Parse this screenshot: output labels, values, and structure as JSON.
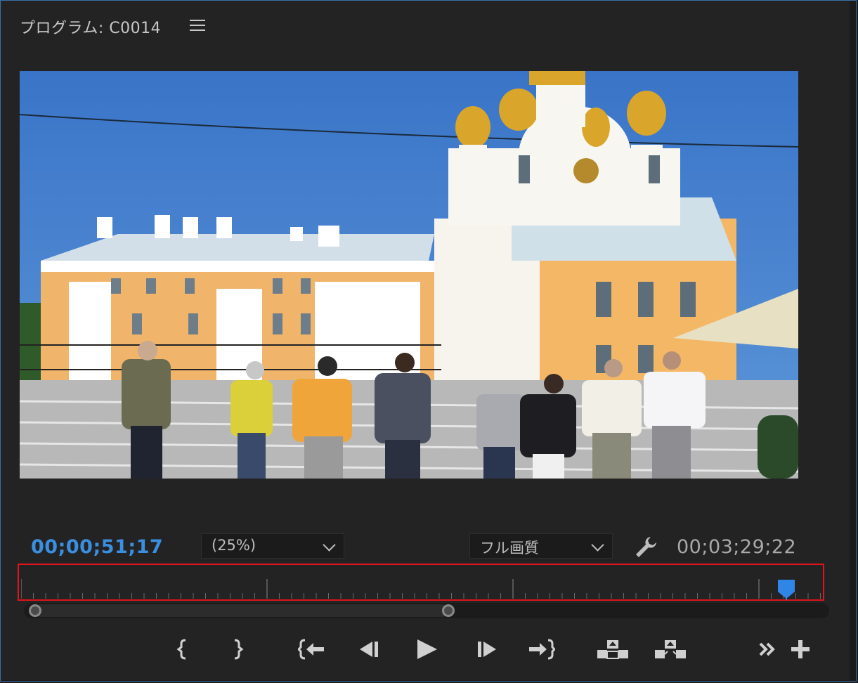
{
  "panel": {
    "title": "プログラム: C0014"
  },
  "playback": {
    "current_timecode": "00;00;51;17",
    "duration_timecode": "00;03;29;22",
    "zoom_level": "(25%)",
    "quality": "フル画質"
  },
  "timeline": {
    "playhead_position_fraction": 0.955,
    "zoom_scroll_start_fraction": 0.0,
    "zoom_scroll_end_fraction": 0.53
  },
  "controls": [
    {
      "name": "mark-in-icon"
    },
    {
      "name": "mark-out-icon"
    },
    {
      "name": "go-to-in-icon"
    },
    {
      "name": "step-back-icon"
    },
    {
      "name": "play-icon"
    },
    {
      "name": "step-forward-icon"
    },
    {
      "name": "go-to-out-icon"
    },
    {
      "name": "lift-icon"
    },
    {
      "name": "extract-icon"
    },
    {
      "name": "more-controls-icon"
    },
    {
      "name": "button-editor-icon"
    }
  ],
  "colors": {
    "accent_timecode": "#3b8fe0",
    "highlight_border": "#e0141b"
  }
}
